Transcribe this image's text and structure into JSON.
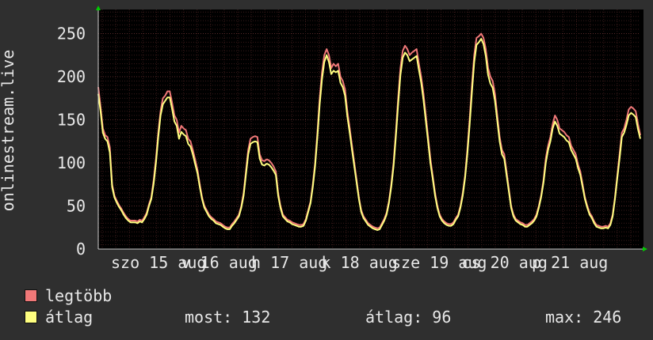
{
  "chart_data": {
    "type": "line",
    "ylabel": "onlinestream.live",
    "ylim": [
      0,
      275
    ],
    "yticks": [
      0,
      50,
      100,
      150,
      200,
      250
    ],
    "x_tick_labels": [
      "szo 15 aug",
      "v 16 aug",
      "h 17 aug",
      "k 18 aug",
      "sze 19 aug",
      "cs 20 aug",
      "p 21 aug"
    ],
    "grid": true,
    "colors": {
      "background": "#000000",
      "grid": "#3a1a1a",
      "axis": "#cccccc",
      "max": "#f07878",
      "avg": "#ffff80",
      "arrow": "#00cc00"
    },
    "series": [
      {
        "name": "legtöbb",
        "values": [
          188,
          165,
          140,
          132,
          130,
          118,
          75,
          62,
          56,
          51,
          47,
          42,
          38,
          35,
          33,
          33,
          33,
          32,
          34,
          33,
          37,
          42,
          52,
          60,
          80,
          105,
          135,
          160,
          175,
          178,
          183,
          183,
          170,
          155,
          150,
          135,
          143,
          140,
          138,
          128,
          125,
          115,
          104,
          92,
          75,
          60,
          50,
          45,
          40,
          37,
          35,
          32,
          31,
          30,
          28,
          26,
          25,
          25,
          29,
          32,
          36,
          40,
          50,
          65,
          90,
          115,
          128,
          130,
          131,
          130,
          110,
          103,
          102,
          104,
          103,
          100,
          96,
          90,
          65,
          50,
          40,
          37,
          34,
          33,
          31,
          30,
          29,
          28,
          28,
          29,
          35,
          45,
          55,
          75,
          100,
          135,
          175,
          205,
          225,
          232,
          225,
          210,
          215,
          212,
          215,
          200,
          195,
          185,
          160,
          140,
          120,
          100,
          80,
          60,
          45,
          38,
          34,
          30,
          28,
          26,
          25,
          24,
          25,
          30,
          35,
          42,
          55,
          75,
          100,
          135,
          175,
          210,
          230,
          236,
          232,
          225,
          228,
          230,
          232,
          215,
          200,
          180,
          155,
          130,
          105,
          85,
          65,
          50,
          40,
          35,
          32,
          30,
          29,
          29,
          31,
          36,
          40,
          50,
          65,
          85,
          115,
          150,
          190,
          225,
          245,
          247,
          250,
          245,
          232,
          210,
          200,
          195,
          180,
          155,
          130,
          115,
          110,
          90,
          70,
          50,
          40,
          35,
          33,
          31,
          30,
          28,
          28,
          30,
          32,
          35,
          40,
          50,
          62,
          80,
          105,
          120,
          130,
          145,
          155,
          150,
          140,
          138,
          136,
          132,
          130,
          120,
          115,
          110,
          98,
          90,
          75,
          60,
          50,
          42,
          38,
          32,
          28,
          27,
          26,
          26,
          27,
          26,
          30,
          40,
          60,
          85,
          110,
          135,
          140,
          150,
          162,
          165,
          163,
          160,
          145,
          132
        ]
      },
      {
        "name": "átlag",
        "values": [
          180,
          160,
          135,
          128,
          125,
          112,
          72,
          60,
          54,
          49,
          45,
          40,
          36,
          33,
          31,
          31,
          31,
          30,
          32,
          31,
          35,
          40,
          50,
          58,
          76,
          100,
          130,
          155,
          168,
          172,
          176,
          176,
          163,
          148,
          143,
          128,
          136,
          133,
          131,
          122,
          119,
          110,
          99,
          88,
          72,
          58,
          48,
          43,
          38,
          35,
          33,
          30,
          29,
          28,
          26,
          24,
          23,
          23,
          27,
          30,
          34,
          38,
          48,
          62,
          86,
          110,
          122,
          124,
          125,
          124,
          105,
          98,
          97,
          99,
          98,
          95,
          91,
          86,
          62,
          48,
          38,
          35,
          32,
          31,
          29,
          28,
          27,
          26,
          26,
          27,
          33,
          43,
          53,
          72,
          96,
          130,
          168,
          197,
          217,
          225,
          217,
          203,
          207,
          205,
          207,
          193,
          188,
          178,
          154,
          135,
          115,
          96,
          77,
          58,
          43,
          36,
          32,
          28,
          26,
          24,
          23,
          22,
          23,
          28,
          33,
          40,
          53,
          72,
          96,
          130,
          168,
          202,
          222,
          228,
          225,
          218,
          220,
          222,
          224,
          208,
          193,
          173,
          149,
          125,
          100,
          82,
          62,
          48,
          38,
          33,
          30,
          28,
          27,
          27,
          29,
          34,
          38,
          48,
          62,
          82,
          110,
          144,
          182,
          217,
          237,
          240,
          244,
          238,
          224,
          202,
          192,
          187,
          172,
          149,
          125,
          110,
          105,
          86,
          67,
          48,
          38,
          33,
          31,
          29,
          28,
          26,
          26,
          28,
          30,
          33,
          38,
          48,
          60,
          77,
          100,
          115,
          125,
          140,
          148,
          143,
          134,
          132,
          130,
          126,
          124,
          115,
          110,
          105,
          94,
          86,
          72,
          58,
          48,
          40,
          36,
          30,
          26,
          25,
          24,
          24,
          25,
          24,
          28,
          38,
          58,
          82,
          105,
          130,
          135,
          144,
          155,
          158,
          156,
          153,
          139,
          128
        ]
      }
    ],
    "legend": [
      {
        "label": "legtöbb",
        "color": "#f07878"
      },
      {
        "label": "átlag",
        "color": "#ffff80"
      }
    ],
    "stats": {
      "most": "most: 132",
      "atlag": "átlag: 96",
      "max": "max: 246"
    }
  }
}
